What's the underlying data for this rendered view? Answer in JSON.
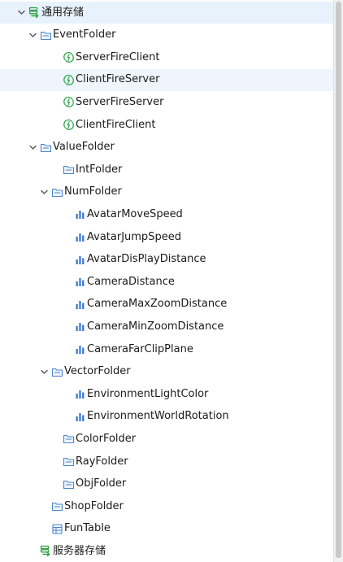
{
  "colors": {
    "selected_row": "#e8f2fc",
    "store_icon": "#2ea043",
    "folder_icon": "#4a86c8",
    "event_icon": "#34a853",
    "value_icon": "#3b78d8",
    "chevron": "#555555"
  },
  "tree": [
    {
      "label": "通用存储",
      "icon": "storage-icon",
      "depth": 0,
      "chevron": "expanded",
      "state": "selected"
    },
    {
      "label": "EventFolder",
      "icon": "folder-icon",
      "depth": 1,
      "chevron": "expanded"
    },
    {
      "label": "ServerFireClient",
      "icon": "event-icon",
      "depth": 3
    },
    {
      "label": "ClientFireServer",
      "icon": "event-icon",
      "depth": 3,
      "state": "hovered"
    },
    {
      "label": "ServerFireServer",
      "icon": "event-icon",
      "depth": 3
    },
    {
      "label": "ClientFireClient",
      "icon": "event-icon",
      "depth": 3
    },
    {
      "label": "ValueFolder",
      "icon": "folder-icon",
      "depth": 1,
      "chevron": "expanded"
    },
    {
      "label": "IntFolder",
      "icon": "folder-icon",
      "depth": 3
    },
    {
      "label": "NumFolder",
      "icon": "folder-icon",
      "depth": 2,
      "chevron": "expanded"
    },
    {
      "label": "AvatarMoveSpeed",
      "icon": "number-value-icon",
      "depth": 4
    },
    {
      "label": "AvatarJumpSpeed",
      "icon": "number-value-icon",
      "depth": 4
    },
    {
      "label": "AvatarDisPlayDistance",
      "icon": "number-value-icon",
      "depth": 4
    },
    {
      "label": "CameraDistance",
      "icon": "number-value-icon",
      "depth": 4
    },
    {
      "label": "CameraMaxZoomDistance",
      "icon": "number-value-icon",
      "depth": 4
    },
    {
      "label": "CameraMinZoomDistance",
      "icon": "number-value-icon",
      "depth": 4
    },
    {
      "label": "CameraFarClipPlane",
      "icon": "number-value-icon",
      "depth": 4
    },
    {
      "label": "VectorFolder",
      "icon": "folder-icon",
      "depth": 2,
      "chevron": "expanded"
    },
    {
      "label": "EnvironmentLightColor",
      "icon": "number-value-icon",
      "depth": 4
    },
    {
      "label": "EnvironmentWorldRotation",
      "icon": "number-value-icon",
      "depth": 4
    },
    {
      "label": "ColorFolder",
      "icon": "folder-icon",
      "depth": 3
    },
    {
      "label": "RayFolder",
      "icon": "folder-icon",
      "depth": 3
    },
    {
      "label": "ObjFolder",
      "icon": "folder-icon",
      "depth": 3
    },
    {
      "label": "ShopFolder",
      "icon": "folder-icon",
      "depth": 2
    },
    {
      "label": "FunTable",
      "icon": "table-icon",
      "depth": 2
    },
    {
      "label": "服务器存储",
      "icon": "storage-icon",
      "depth": 1
    }
  ]
}
